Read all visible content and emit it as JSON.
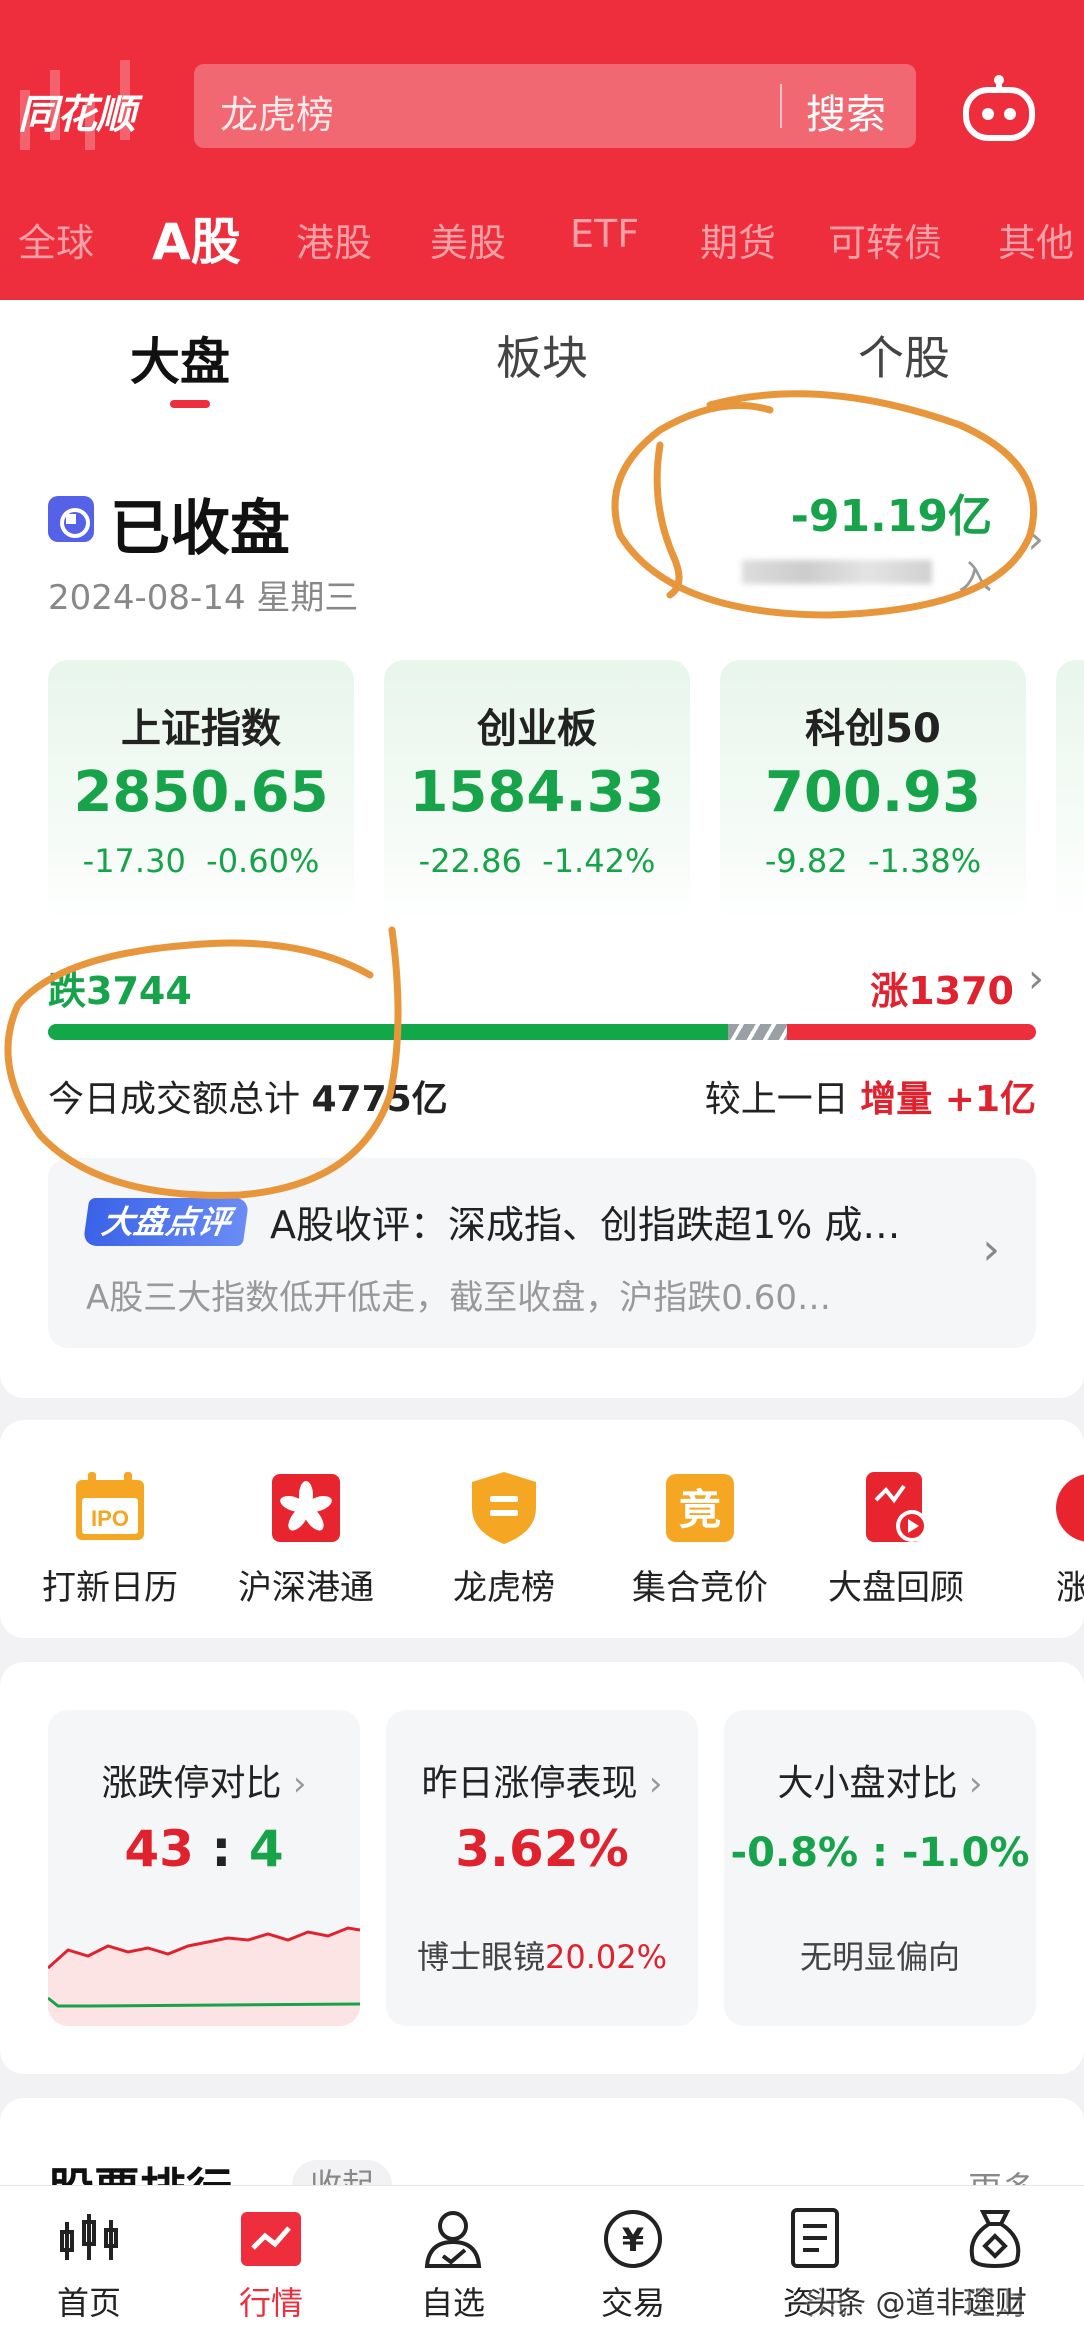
{
  "header": {
    "logo_text": "同花顺",
    "search_placeholder": "龙虎榜",
    "search_button": "搜索",
    "market_tabs": [
      "全球",
      "A股",
      "港股",
      "美股",
      "ETF",
      "期货",
      "可转债",
      "其他"
    ],
    "active_market_tab": "A股"
  },
  "sub_tabs": [
    "大盘",
    "板块",
    "个股"
  ],
  "market": {
    "status": "已收盘",
    "date": "2024-08-14 星期三",
    "net_flow": "-91.19亿",
    "net_flow_label": "入",
    "indices": [
      {
        "name": "上证指数",
        "value": "2850.65",
        "change": "-17.30",
        "pct": "-0.60%"
      },
      {
        "name": "创业板",
        "value": "1584.33",
        "change": "-22.86",
        "pct": "-1.42%"
      },
      {
        "name": "科创50",
        "value": "700.93",
        "change": "-9.82",
        "pct": "-1.38%"
      }
    ],
    "down_count_label": "跌3744",
    "up_count_label": "涨1370",
    "breadth": {
      "down": 3744,
      "flat": 0.06,
      "up": 1370
    },
    "turnover_label": "今日成交额总计",
    "turnover_value": "4775亿",
    "compare_label": "较上一日",
    "compare_value": "增量 +1亿"
  },
  "review": {
    "tag": "大盘点评",
    "title": "A股收评：深成指、创指跌超1% 成…",
    "summary": "A股三大指数低开低走，截至收盘，沪指跌0.60…"
  },
  "quick_access": [
    {
      "label": "打新日历",
      "icon": "ipo-calendar-icon",
      "icon_text": "IPO"
    },
    {
      "label": "沪深港通",
      "icon": "hk-flower-icon",
      "icon_text": "✿"
    },
    {
      "label": "龙虎榜",
      "icon": "shield-icon",
      "icon_text": "="
    },
    {
      "label": "集合竞价",
      "icon": "auction-icon",
      "icon_text": "竟"
    },
    {
      "label": "大盘回顾",
      "icon": "play-review-icon",
      "icon_text": ""
    },
    {
      "label": "涨停",
      "icon": "limit-up-icon",
      "icon_text": ""
    }
  ],
  "stats": [
    {
      "title": "涨跌停对比",
      "value_left": "43",
      "sep": ":",
      "value_right": "4"
    },
    {
      "title": "昨日涨停表现",
      "value": "3.62%",
      "sub_label": "博士眼镜",
      "sub_value": "20.02%"
    },
    {
      "title": "大小盘对比",
      "value": "-0.8% : -1.0%",
      "sub_label": "无明显偏向"
    }
  ],
  "ranking": {
    "title": "股票排行",
    "toggle": "收起",
    "more": "更多"
  },
  "bottom_nav": [
    {
      "label": "首页",
      "icon": "home-chart-icon"
    },
    {
      "label": "行情",
      "icon": "market-icon",
      "active": true
    },
    {
      "label": "自选",
      "icon": "watchlist-user-icon"
    },
    {
      "label": "交易",
      "icon": "yuan-icon"
    },
    {
      "label": "资讯",
      "icon": "news-doc-icon"
    },
    {
      "label": "理财",
      "icon": "money-bag-icon"
    }
  ],
  "watermark": "头条 @道非途上",
  "colors": {
    "brand_red": "#ee2e3c",
    "down_green": "#16a34a",
    "up_red": "#e0222f",
    "annotation": "#e8963c"
  }
}
